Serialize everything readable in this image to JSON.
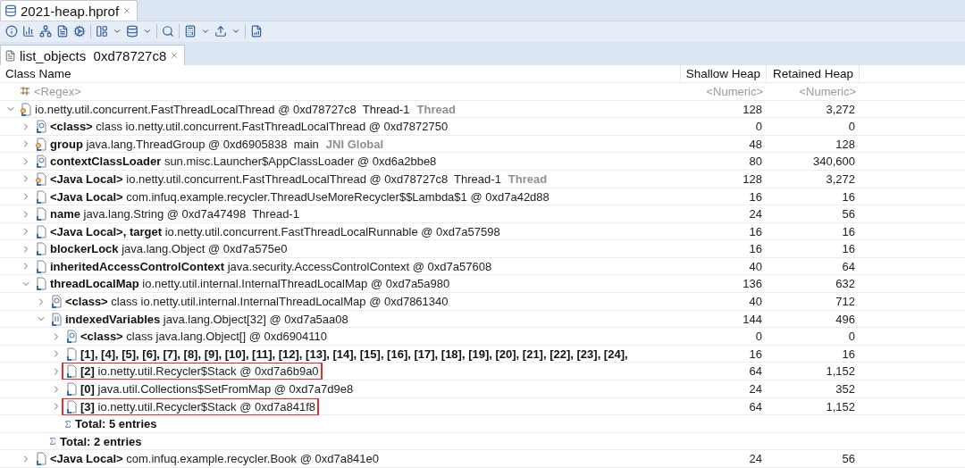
{
  "editor_tab": {
    "title": "2021-heap.hprof",
    "selected": true
  },
  "result_tab": {
    "title": "list_objects  0xd78727c8",
    "selected": true
  },
  "table": {
    "columns": [
      "Class Name",
      "Shallow Heap",
      "Retained Heap"
    ],
    "filters": [
      {
        "placeholder": "<Regex>"
      },
      {
        "placeholder": "<Numeric>"
      },
      {
        "placeholder": "<Numeric>"
      }
    ],
    "rows": [
      {
        "kind": "thread",
        "text": "io.netty.util.concurrent.FastThreadLocalThread @ 0xd78727c8  Thread-1",
        "tag": "Thread",
        "shallow": "128",
        "retained": "3,272",
        "expanded": true,
        "highlighted": false,
        "children": [
          {
            "kind": "class",
            "label": "<class>",
            "text": "class io.netty.util.concurrent.FastThreadLocalThread @ 0xd7872750",
            "shallow": "0",
            "retained": "0",
            "expanded": false,
            "highlighted": false
          },
          {
            "kind": "thread",
            "label": "group",
            "text": "java.lang.ThreadGroup @ 0xd6905838  main",
            "tag": "JNI Global",
            "shallow": "48",
            "retained": "128",
            "expanded": false,
            "highlighted": false
          },
          {
            "kind": "class",
            "label": "contextClassLoader",
            "text": "sun.misc.Launcher$AppClassLoader @ 0xd6a2bbe8",
            "shallow": "80",
            "retained": "340,600",
            "expanded": false,
            "highlighted": false
          },
          {
            "kind": "thread",
            "label": "<Java Local>",
            "text": "io.netty.util.concurrent.FastThreadLocalThread @ 0xd78727c8  Thread-1",
            "tag": "Thread",
            "shallow": "128",
            "retained": "3,272",
            "expanded": false,
            "highlighted": false
          },
          {
            "kind": "object",
            "label": "<Java Local>",
            "text": "com.infuq.example.recycler.ThreadUseMoreRecycler$$Lambda$1 @ 0xd7a42d88",
            "shallow": "16",
            "retained": "16",
            "expanded": false,
            "highlighted": false
          },
          {
            "kind": "object",
            "label": "name",
            "text": "java.lang.String @ 0xd7a47498  Thread-1",
            "shallow": "24",
            "retained": "56",
            "expanded": false,
            "highlighted": false
          },
          {
            "kind": "object",
            "label": "<Java Local>, target",
            "text": "io.netty.util.concurrent.FastThreadLocalRunnable @ 0xd7a57598",
            "shallow": "16",
            "retained": "16",
            "expanded": false,
            "highlighted": false
          },
          {
            "kind": "object",
            "label": "blockerLock",
            "text": "java.lang.Object @ 0xd7a575e0",
            "shallow": "16",
            "retained": "16",
            "expanded": false,
            "highlighted": false
          },
          {
            "kind": "object",
            "label": "inheritedAccessControlContext",
            "text": "java.security.AccessControlContext @ 0xd7a57608",
            "shallow": "40",
            "retained": "64",
            "expanded": false,
            "highlighted": false
          },
          {
            "kind": "object",
            "label": "threadLocalMap",
            "text": "io.netty.util.internal.InternalThreadLocalMap @ 0xd7a5a980",
            "shallow": "136",
            "retained": "632",
            "expanded": true,
            "highlighted": false,
            "children": [
              {
                "kind": "class",
                "label": "<class>",
                "text": "class io.netty.util.internal.InternalThreadLocalMap @ 0xd7861340",
                "shallow": "40",
                "retained": "712",
                "expanded": false,
                "highlighted": false
              },
              {
                "kind": "array",
                "label": "indexedVariables",
                "text": "java.lang.Object[32] @ 0xd7a5aa08",
                "shallow": "144",
                "retained": "496",
                "expanded": true,
                "highlighted": false,
                "children": [
                  {
                    "kind": "class",
                    "label": "<class>",
                    "text": "class java.lang.Object[] @ 0xd6904110",
                    "shallow": "0",
                    "retained": "0",
                    "expanded": false,
                    "highlighted": false
                  },
                  {
                    "kind": "object",
                    "label": "[1], [4], [5], [6], [7], [8], [9], [10], [11], [12], [13], [14], [15], [16], [17], [18], [19], [20], [21], [22], [23], [24],",
                    "shallow": "16",
                    "retained": "16",
                    "expanded": false,
                    "highlighted": false
                  },
                  {
                    "kind": "object",
                    "label": "[2]",
                    "text": "io.netty.util.Recycler$Stack @ 0xd7a6b9a0",
                    "shallow": "64",
                    "retained": "1,152",
                    "expanded": false,
                    "highlighted": true
                  },
                  {
                    "kind": "object",
                    "label": "[0]",
                    "text": "java.util.Collections$SetFromMap @ 0xd7a7d9e8",
                    "shallow": "24",
                    "retained": "352",
                    "expanded": false,
                    "highlighted": false
                  },
                  {
                    "kind": "object",
                    "label": "[3]",
                    "text": "io.netty.util.Recycler$Stack @ 0xd7a841f8",
                    "shallow": "64",
                    "retained": "1,152",
                    "expanded": false,
                    "highlighted": true
                  },
                  {
                    "kind": "total",
                    "label": "Total: 5 entries"
                  }
                ]
              },
              {
                "kind": "total",
                "label": "Total: 2 entries"
              }
            ]
          },
          {
            "kind": "object",
            "label": "<Java Local>",
            "text": "com.infuq.example.recycler.Book @ 0xd7a841e0",
            "shallow": "24",
            "retained": "56",
            "expanded": false,
            "highlighted": false
          }
        ]
      }
    ]
  }
}
